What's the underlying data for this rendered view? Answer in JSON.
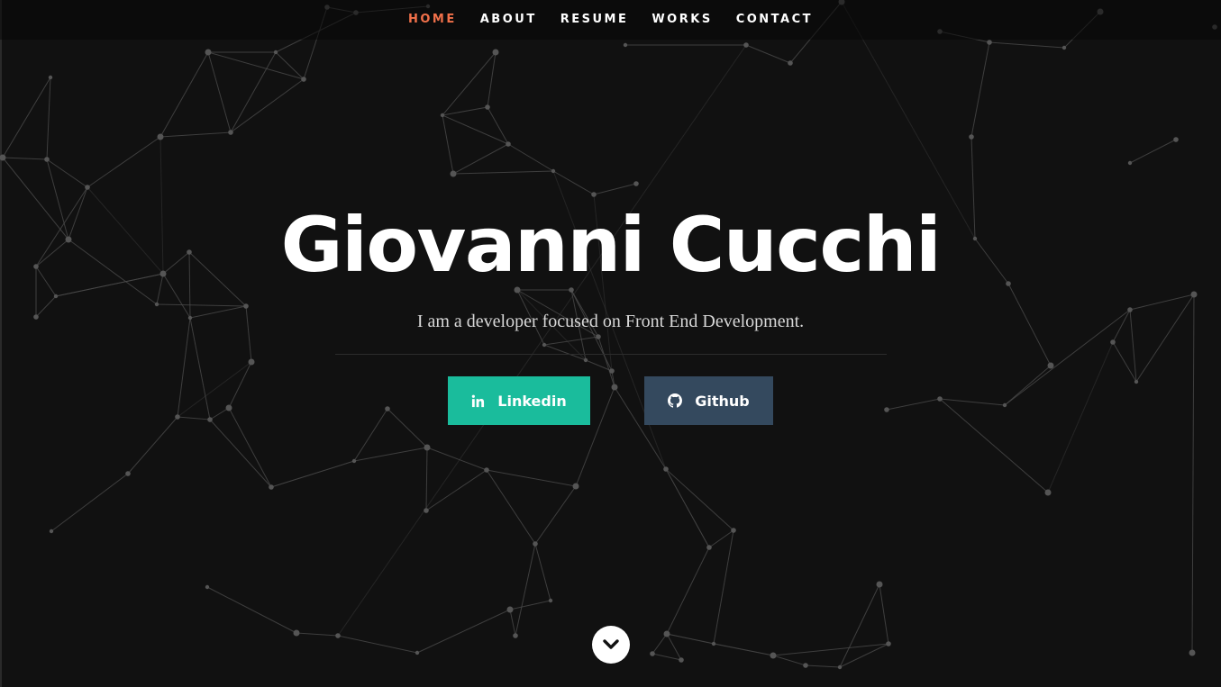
{
  "nav": {
    "items": [
      {
        "label": "HOME",
        "active": true
      },
      {
        "label": "ABOUT",
        "active": false
      },
      {
        "label": "RESUME",
        "active": false
      },
      {
        "label": "WORKS",
        "active": false
      },
      {
        "label": "CONTACT",
        "active": false
      }
    ]
  },
  "hero": {
    "title": "Giovanni Cucchi",
    "tagline": "I am a developer focused on Front End Development."
  },
  "buttons": {
    "linkedin": {
      "label": "Linkedin",
      "icon": "linkedin-icon",
      "color": "#1abc9c"
    },
    "github": {
      "label": "Github",
      "icon": "github-icon",
      "color": "#34495e"
    }
  },
  "scroll": {
    "icon": "chevron-down-icon"
  },
  "colors": {
    "background": "#111111",
    "accent": "#f0704a",
    "network_line": "#4a4a4a",
    "network_node": "#555555"
  }
}
